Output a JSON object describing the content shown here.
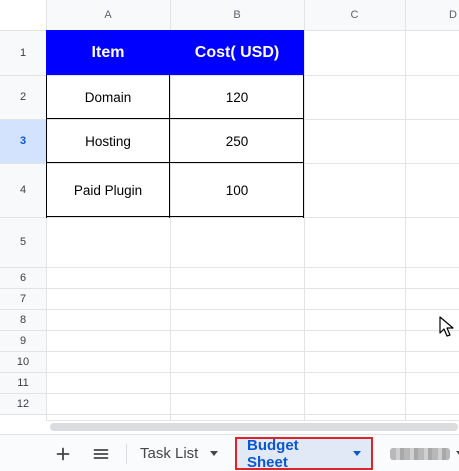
{
  "columns": [
    "A",
    "B",
    "C",
    "D"
  ],
  "rows": [
    "1",
    "2",
    "3",
    "4",
    "5",
    "6",
    "7",
    "8",
    "9",
    "10",
    "11",
    "12"
  ],
  "selected_row": "3",
  "table": {
    "header": [
      "Item",
      "Cost( USD)"
    ],
    "body": [
      [
        "Domain",
        "120"
      ],
      [
        "Hosting",
        "250"
      ],
      [
        "Paid Plugin",
        "100"
      ]
    ]
  },
  "colors": {
    "header_fill": "#0000ff",
    "header_text": "#ffffff",
    "active_tab_text": "#0b57d0",
    "active_tab_outline": "#e0222a"
  },
  "tabs": [
    {
      "label": "Task List",
      "active": false
    },
    {
      "label": "Budget Sheet",
      "active": true
    },
    {
      "label": "",
      "active": false,
      "obscured": true
    }
  ],
  "icons": {
    "add_sheet": "plus-icon",
    "all_sheets": "menu-icon",
    "tab_menu": "caret-down-icon",
    "pointer": "mouse-cursor-icon"
  }
}
